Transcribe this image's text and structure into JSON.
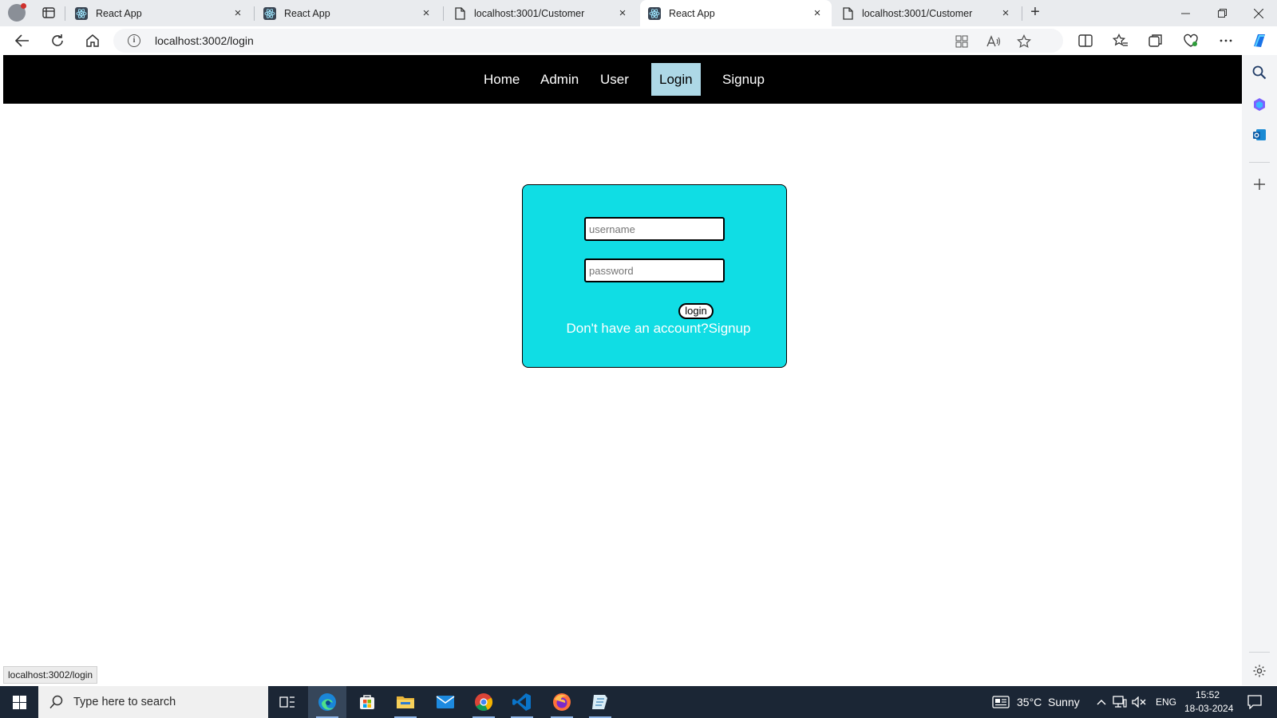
{
  "browser": {
    "tabs": [
      {
        "title": "React App",
        "favicon": "react-icon",
        "active": false
      },
      {
        "title": "React App",
        "favicon": "react-icon",
        "active": false
      },
      {
        "title": "localhost:3001/Customer",
        "favicon": "page-icon",
        "active": false
      },
      {
        "title": "React App",
        "favicon": "react-icon",
        "active": true
      },
      {
        "title": "localhost:3001/Customer",
        "favicon": "page-icon",
        "active": false
      }
    ],
    "close_glyph": "×",
    "new_tab_glyph": "+",
    "address": "localhost:3002/login",
    "status_url": "localhost:3002/login"
  },
  "navbar": {
    "items": [
      {
        "label": "Home",
        "active": false
      },
      {
        "label": "Admin",
        "active": false
      },
      {
        "label": "User",
        "active": false
      },
      {
        "label": "Login",
        "active": true
      },
      {
        "label": "Signup",
        "active": false
      }
    ]
  },
  "login": {
    "username_placeholder": "username",
    "password_placeholder": "password",
    "button_label": "login",
    "prompt_text": "Don't have an account?",
    "signup_link": "Signup",
    "card_color": "#10dde4"
  },
  "taskbar": {
    "search_placeholder": "Type here to search",
    "weather": "35°C  Sunny",
    "language": "ENG",
    "time": "15:52",
    "date": "18-03-2024"
  },
  "colors": {
    "navbar_bg": "#000000",
    "nav_active_bg": "#add8e6",
    "taskbar_bg": "#1b2635"
  }
}
